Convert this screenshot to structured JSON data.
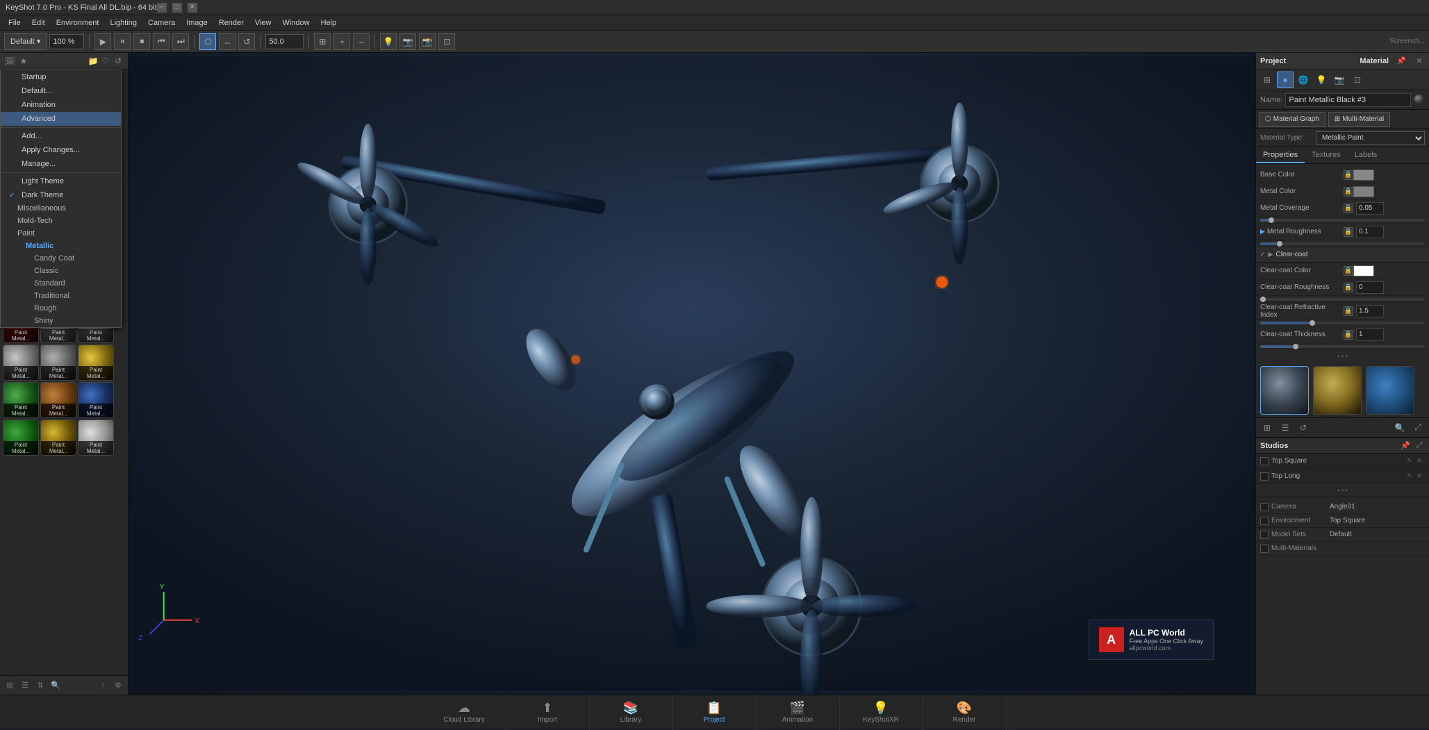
{
  "titlebar": {
    "title": "KeyShot 7.0 Pro - KS Final All DL.bip - 64 bit",
    "controls": [
      "minimize",
      "maximize",
      "close"
    ]
  },
  "menubar": {
    "items": [
      "File",
      "Edit",
      "Environment",
      "Lighting",
      "Camera",
      "Image",
      "Render",
      "View",
      "Window",
      "Help"
    ]
  },
  "toolbar": {
    "camera_preset": "Default",
    "zoom_percent": "100 %",
    "numeric_field": "50.0"
  },
  "left_panel": {
    "header_icons": [
      "photo",
      "star",
      "folder-open",
      "star",
      "refresh"
    ],
    "dropdown": {
      "items": [
        {
          "label": "Startup",
          "indent": 0,
          "check": false
        },
        {
          "label": "Default...",
          "indent": 0,
          "check": false
        },
        {
          "label": "Animation",
          "indent": 0,
          "check": false
        },
        {
          "label": "Advanced",
          "indent": 0,
          "check": false
        },
        {
          "label": "separator"
        },
        {
          "label": "Add...",
          "indent": 0,
          "check": false
        },
        {
          "label": "Apply Changes...",
          "indent": 0,
          "check": false
        },
        {
          "label": "Manage...",
          "indent": 0,
          "check": false
        },
        {
          "label": "separator"
        },
        {
          "label": "Light Theme",
          "indent": 0,
          "check": false
        },
        {
          "label": "Dark Theme",
          "indent": 0,
          "check": true
        },
        {
          "label": "Miscellaneous",
          "indent": 1,
          "check": false
        },
        {
          "label": "Mold-Tech",
          "indent": 1,
          "check": false
        },
        {
          "label": "Paint",
          "indent": 1,
          "check": false
        },
        {
          "label": "Metallic",
          "indent": 2,
          "check": false,
          "active": true
        },
        {
          "label": "Candy Coat",
          "indent": 3,
          "check": false
        },
        {
          "label": "Classic",
          "indent": 3,
          "check": false
        },
        {
          "label": "Standard",
          "indent": 3,
          "check": false
        },
        {
          "label": "Traditional",
          "indent": 3,
          "check": false
        },
        {
          "label": "Rough",
          "indent": 3,
          "check": false
        },
        {
          "label": "Shiny",
          "indent": 3,
          "check": false
        }
      ]
    },
    "materials": [
      {
        "label": "Paint Metal...",
        "class": "mat-gold"
      },
      {
        "label": "Paint Metal...",
        "class": "mat-black"
      },
      {
        "label": "Paint Metal...",
        "class": "mat-blue-metal"
      },
      {
        "label": "Paint Metal...",
        "class": "mat-blue"
      },
      {
        "label": "Paint Metal...",
        "class": "mat-green"
      },
      {
        "label": "Paint Metal...",
        "class": "mat-red"
      },
      {
        "label": "Paint Metal...",
        "class": "mat-red2"
      },
      {
        "label": "Paint Metal...",
        "class": "mat-silver"
      },
      {
        "label": "Paint Metal...",
        "class": "mat-silver2"
      },
      {
        "label": "Paint Metal...",
        "class": "mat-silver3"
      },
      {
        "label": "Paint Metal...",
        "class": "mat-silver4"
      },
      {
        "label": "Paint Metal...",
        "class": "mat-gold2"
      },
      {
        "label": "Paint Metal...",
        "class": "mat-green2"
      },
      {
        "label": "Paint Metal...",
        "class": "mat-bronze"
      },
      {
        "label": "Paint Metal...",
        "class": "mat-blue2"
      },
      {
        "label": "Paint Metal...",
        "class": "mat-green3"
      },
      {
        "label": "Paint Metal...",
        "class": "mat-gold3"
      },
      {
        "label": "Paint Metal...",
        "class": "mat-silver"
      }
    ]
  },
  "right_panel": {
    "project_label": "Project",
    "material_label": "Material",
    "tab_icons": [
      "grid",
      "circle",
      "globe",
      "lightbulb",
      "camera",
      "layers"
    ],
    "material_name": {
      "label": "Name:",
      "value": "Paint Metallic Black #3"
    },
    "graph_buttons": [
      {
        "label": "Material Graph",
        "icon": "⬡",
        "active": false
      },
      {
        "label": "Multi-Material",
        "icon": "⊞",
        "active": false
      }
    ],
    "material_type": {
      "label": "Material Type:",
      "value": "Metallic Paint"
    },
    "sub_tabs": [
      "Properties",
      "Textures",
      "Labels"
    ],
    "properties": [
      {
        "label": "Base Color",
        "type": "color",
        "swatch_class": "swatch-dark"
      },
      {
        "label": "Metal Color",
        "type": "color",
        "swatch_class": "swatch-grey"
      },
      {
        "label": "Metal Coverage",
        "type": "value",
        "value": "0.05",
        "slider_pct": 5
      },
      {
        "label": "Metal Roughness",
        "type": "value",
        "value": "0.1",
        "slider_pct": 10,
        "expandable": true
      }
    ],
    "clearcoat": {
      "label": "Clear-coat",
      "enabled": true,
      "properties": [
        {
          "label": "Clear-coat Color",
          "type": "color",
          "swatch_class": "swatch-white"
        },
        {
          "label": "Clear-coat Roughness",
          "type": "value",
          "value": "0",
          "slider_pct": 0
        },
        {
          "label": "Clear-coat Refractive Index",
          "type": "value",
          "value": "1.5",
          "slider_pct": 30
        },
        {
          "label": "Clear-coat Thickness",
          "type": "value",
          "value": "1",
          "slider_pct": 20
        }
      ]
    },
    "expand_label": "• • •",
    "preview_thumbs": [
      {
        "class": "thumb-scene mat-preview-thumb active"
      },
      {
        "class": "thumb-dots mat-preview-thumb"
      },
      {
        "class": "thumb-earth mat-preview-thumb"
      }
    ],
    "thumb_toolbar": [
      "grid",
      "list",
      "refresh",
      "search",
      "upload",
      "settings"
    ],
    "studios": {
      "label": "Studios",
      "items": [
        {
          "name": "Top Square",
          "checked": false
        },
        {
          "name": "Top Long",
          "checked": false
        }
      ]
    },
    "expand_row_label": "• • •",
    "camera_rows": [
      {
        "label": "Camera",
        "value": "Angle01"
      },
      {
        "label": "Environment",
        "value": "Top Square"
      },
      {
        "label": "Model Sets",
        "value": "Default"
      },
      {
        "label": "Multi-Materials",
        "value": ""
      }
    ]
  },
  "bottom_bar": {
    "buttons": [
      {
        "icon": "☁",
        "label": "Cloud Library",
        "active": false
      },
      {
        "icon": "↑",
        "label": "Import",
        "active": false
      },
      {
        "icon": "📚",
        "label": "Library",
        "active": false
      },
      {
        "icon": "📋",
        "label": "Project",
        "active": true
      },
      {
        "icon": "🎬",
        "label": "Animation",
        "active": false
      },
      {
        "icon": "💡",
        "label": "KeyShotXR",
        "active": false
      },
      {
        "icon": "🎨",
        "label": "Render",
        "active": false
      }
    ]
  },
  "viewport": {
    "status_text": "Screensh..."
  },
  "watermark": {
    "line1": "ALL PC World",
    "line2": "Free Apps One Click Away",
    "line3": "allpcworld.com"
  }
}
